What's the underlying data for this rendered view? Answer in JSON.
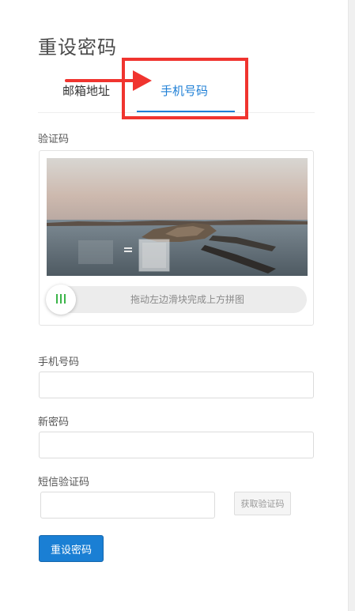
{
  "page": {
    "title": "重设密码"
  },
  "tabs": [
    {
      "label": "邮箱地址",
      "active": false
    },
    {
      "label": "手机号码",
      "active": true
    }
  ],
  "captcha": {
    "label": "验证码",
    "slider_text": "拖动左边滑块完成上方拼图",
    "slider_progress": 0
  },
  "form": {
    "phone": {
      "label": "手机号码",
      "value": "",
      "placeholder": ""
    },
    "new_password": {
      "label": "新密码",
      "value": "",
      "placeholder": ""
    },
    "sms_code": {
      "label": "短信验证码",
      "value": "",
      "placeholder": "",
      "button_label": "获取验证码"
    },
    "submit_label": "重设密码"
  },
  "colors": {
    "accent": "#1e7fd6",
    "annotation": "#f0342f",
    "slider_handle_bars": "#3cb54a"
  },
  "icons": {
    "slider_handle": "three-bars-icon",
    "annotation_arrow": "arrow-right-icon"
  }
}
